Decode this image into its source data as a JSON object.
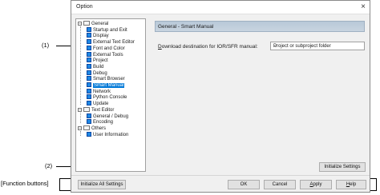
{
  "annotations": {
    "label_1": "(1)",
    "label_2": "(2)",
    "label_fb": "[Function buttons]"
  },
  "window": {
    "title": "Option",
    "close_symbol": "×"
  },
  "tree": {
    "expand_symbol": "−",
    "items": [
      {
        "label": "General",
        "kind": "group"
      },
      {
        "label": "Startup and Exit",
        "kind": "page"
      },
      {
        "label": "Display",
        "kind": "page"
      },
      {
        "label": "External Text Editor",
        "kind": "page"
      },
      {
        "label": "Font and Color",
        "kind": "page"
      },
      {
        "label": "External Tools",
        "kind": "page"
      },
      {
        "label": "Project",
        "kind": "page"
      },
      {
        "label": "Build",
        "kind": "page"
      },
      {
        "label": "Debug",
        "kind": "page"
      },
      {
        "label": "Smart Browser",
        "kind": "page"
      },
      {
        "label": "Smart Manual",
        "kind": "page",
        "selected": true
      },
      {
        "label": "Network",
        "kind": "page"
      },
      {
        "label": "Python Console",
        "kind": "page"
      },
      {
        "label": "Update",
        "kind": "page"
      },
      {
        "label": "Text Editor",
        "kind": "group"
      },
      {
        "label": "General / Debug",
        "kind": "page"
      },
      {
        "label": "Encoding",
        "kind": "page"
      },
      {
        "label": "Others",
        "kind": "group"
      },
      {
        "label": "User Information",
        "kind": "page"
      }
    ]
  },
  "content": {
    "header": "General - Smart Manual",
    "download_label_accel": "D",
    "download_label_rest": "ownload destination for IOR/SFR manual:",
    "download_value": "Project or subproject folder",
    "dropdown_chevron": "⌄",
    "initialize_settings": "Initialize Settings"
  },
  "footer": {
    "initialize_all": "Initialize All Settings",
    "ok": "OK",
    "cancel": "Cancel",
    "apply_accel": "A",
    "apply_rest": "pply",
    "help_accel": "H",
    "help_rest": "elp"
  }
}
